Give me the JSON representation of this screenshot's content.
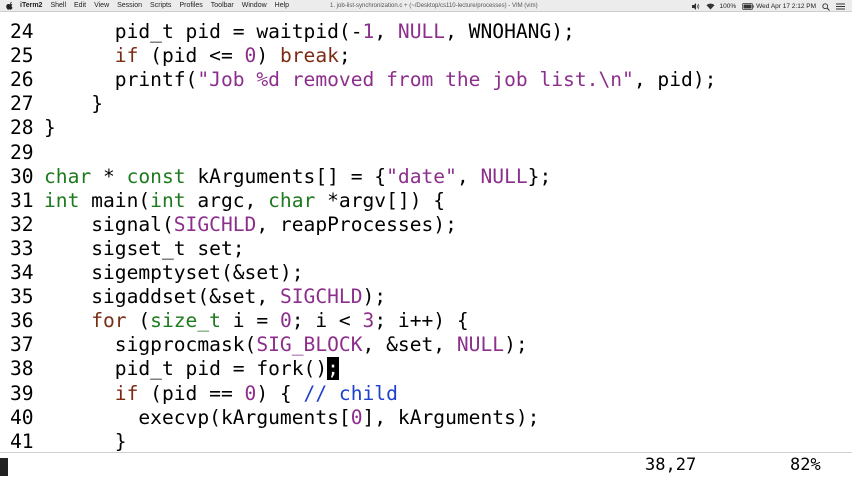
{
  "menubar": {
    "app_name": "iTerm2",
    "items": [
      "Shell",
      "Edit",
      "View",
      "Session",
      "Scripts",
      "Profiles",
      "Toolbar",
      "Window",
      "Help"
    ],
    "window_title": "1. job-list-synchronization.c + (~/Desktop/cs110-lecture/processes) - VIM (vim)",
    "clock": "Wed Apr 17 2:12 PM",
    "battery": "100%"
  },
  "editor": {
    "lines": [
      {
        "n": "24",
        "indent": "      ",
        "segments": [
          [
            "",
            "pid_t pid = waitpid(-"
          ],
          [
            "num",
            "1"
          ],
          [
            "",
            ", "
          ],
          [
            "cst",
            "NULL"
          ],
          [
            "",
            ", WNOHANG);"
          ]
        ]
      },
      {
        "n": "25",
        "indent": "      ",
        "segments": [
          [
            "kw",
            "if"
          ],
          [
            "",
            " (pid <= "
          ],
          [
            "num",
            "0"
          ],
          [
            "",
            ") "
          ],
          [
            "kw",
            "break"
          ],
          [
            "",
            ";"
          ]
        ]
      },
      {
        "n": "26",
        "indent": "      ",
        "segments": [
          [
            "",
            "printf("
          ],
          [
            "str",
            "\"Job "
          ],
          [
            "num",
            "%d"
          ],
          [
            "str",
            " removed from the job list."
          ],
          [
            "num",
            "\\n"
          ],
          [
            "str",
            "\""
          ],
          [
            "",
            ", pid);"
          ]
        ]
      },
      {
        "n": "27",
        "indent": "    ",
        "segments": [
          [
            "",
            "}"
          ]
        ]
      },
      {
        "n": "28",
        "indent": "",
        "segments": [
          [
            "",
            "}"
          ]
        ]
      },
      {
        "n": "29",
        "indent": "",
        "segments": []
      },
      {
        "n": "30",
        "indent": "",
        "segments": [
          [
            "typ",
            "char"
          ],
          [
            "",
            " * "
          ],
          [
            "typ",
            "const"
          ],
          [
            "",
            " kArguments[] = {"
          ],
          [
            "str",
            "\"date\""
          ],
          [
            "",
            ", "
          ],
          [
            "cst",
            "NULL"
          ],
          [
            "",
            "};"
          ]
        ]
      },
      {
        "n": "31",
        "indent": "",
        "segments": [
          [
            "typ",
            "int"
          ],
          [
            "",
            " main("
          ],
          [
            "typ",
            "int"
          ],
          [
            "",
            " argc, "
          ],
          [
            "typ",
            "char"
          ],
          [
            "",
            " *argv[]) {"
          ]
        ]
      },
      {
        "n": "32",
        "indent": "    ",
        "segments": [
          [
            "",
            "signal("
          ],
          [
            "cst",
            "SIGCHLD"
          ],
          [
            "",
            ", reapProcesses);"
          ]
        ]
      },
      {
        "n": "33",
        "indent": "    ",
        "segments": [
          [
            "",
            "sigset_t set;"
          ]
        ]
      },
      {
        "n": "34",
        "indent": "    ",
        "segments": [
          [
            "",
            "sigemptyset(&set);"
          ]
        ]
      },
      {
        "n": "35",
        "indent": "    ",
        "segments": [
          [
            "",
            "sigaddset(&set, "
          ],
          [
            "cst",
            "SIGCHLD"
          ],
          [
            "",
            ");"
          ]
        ]
      },
      {
        "n": "36",
        "indent": "    ",
        "segments": [
          [
            "kw",
            "for"
          ],
          [
            "",
            " ("
          ],
          [
            "typ",
            "size_t"
          ],
          [
            "",
            " i = "
          ],
          [
            "num",
            "0"
          ],
          [
            "",
            "; i < "
          ],
          [
            "num",
            "3"
          ],
          [
            "",
            "; i++) {"
          ]
        ]
      },
      {
        "n": "37",
        "indent": "      ",
        "segments": [
          [
            "",
            "sigprocmask("
          ],
          [
            "cst",
            "SIG_BLOCK"
          ],
          [
            "",
            ", &set, "
          ],
          [
            "cst",
            "NULL"
          ],
          [
            "",
            ");"
          ]
        ]
      },
      {
        "n": "38",
        "indent": "      ",
        "segments": [
          [
            "",
            "pid_t pid = fork()"
          ],
          [
            "cursor",
            ";"
          ]
        ]
      },
      {
        "n": "39",
        "indent": "      ",
        "segments": [
          [
            "kw",
            "if"
          ],
          [
            "",
            " (pid == "
          ],
          [
            "num",
            "0"
          ],
          [
            "",
            ") { "
          ],
          [
            "cmt",
            "// child"
          ]
        ]
      },
      {
        "n": "40",
        "indent": "        ",
        "segments": [
          [
            "",
            "execvp(kArguments["
          ],
          [
            "num",
            "0"
          ],
          [
            "",
            "], kArguments);"
          ]
        ]
      },
      {
        "n": "41",
        "indent": "      ",
        "segments": [
          [
            "",
            "}"
          ]
        ]
      }
    ]
  },
  "status": {
    "cursor_position": "38,27",
    "scroll_percent": "82%"
  }
}
